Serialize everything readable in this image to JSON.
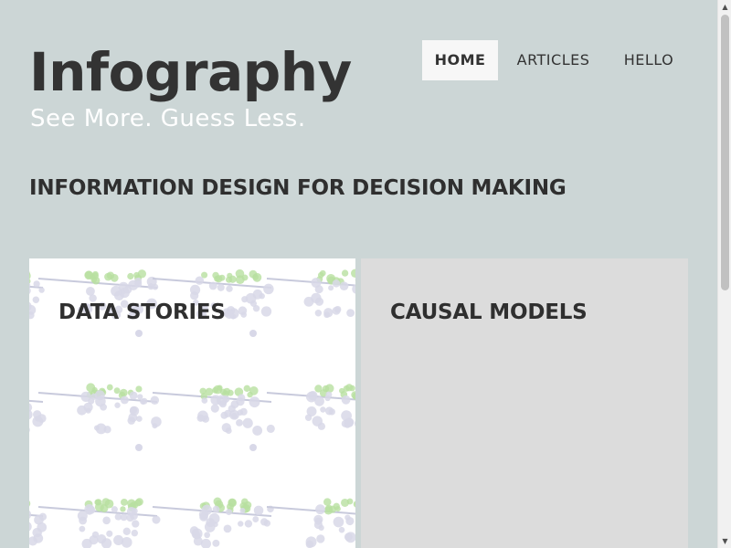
{
  "brand": {
    "title": "Infography",
    "tagline": "See More. Guess Less."
  },
  "nav": {
    "items": [
      {
        "label": "HOME",
        "active": true
      },
      {
        "label": "ARTICLES",
        "active": false
      },
      {
        "label": "HELLO",
        "active": false
      }
    ]
  },
  "headline": "INFORMATION DESIGN FOR DECISION MAKING",
  "cards": [
    {
      "title": "DATA STORIES"
    },
    {
      "title": "CAUSAL MODELS"
    }
  ],
  "colors": {
    "page_bg": "#ccd6d6",
    "text": "#333333",
    "tagline": "#ffffff",
    "active_nav_bg": "#f7f7f7",
    "card_data_bg": "#ffffff",
    "card_causal_bg": "#dcdcdc",
    "pattern_dots": "#d8d8e8",
    "pattern_green": "#b8e0a0"
  },
  "scrollbar": {
    "up_icon": "triangle-up-icon",
    "down_icon": "triangle-down-icon"
  }
}
